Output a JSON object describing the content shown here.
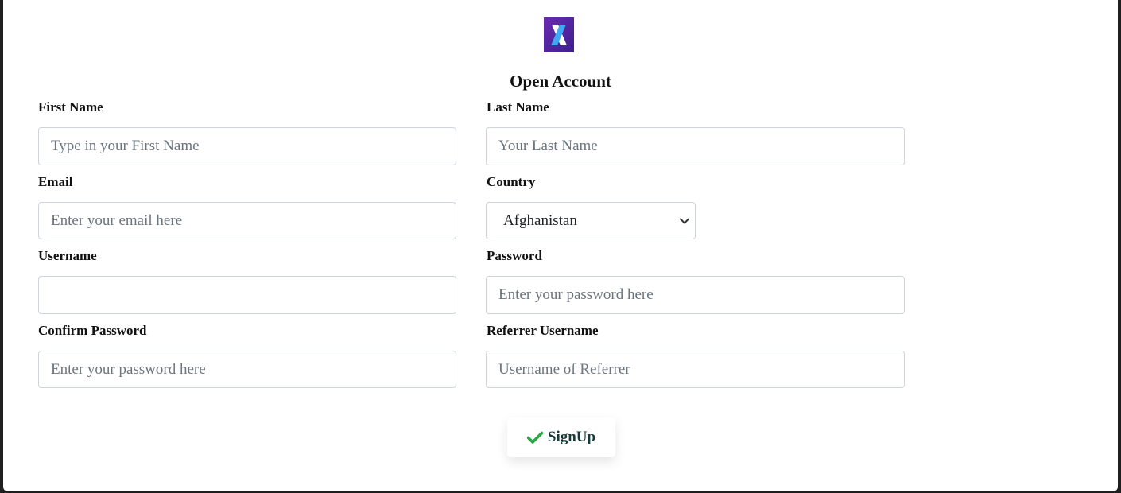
{
  "form": {
    "title": "Open Account",
    "fields": {
      "first_name": {
        "label": "First Name",
        "placeholder": "Type in your First Name",
        "value": ""
      },
      "last_name": {
        "label": "Last Name",
        "placeholder": "Your Last Name",
        "value": ""
      },
      "email": {
        "label": "Email",
        "placeholder": "Enter your email here",
        "value": ""
      },
      "country": {
        "label": "Country",
        "selected": "Afghanistan",
        "icon": "chevron-down-icon"
      },
      "username": {
        "label": "Username",
        "placeholder": "",
        "value": ""
      },
      "password": {
        "label": "Password",
        "placeholder": "Enter your password here",
        "value": ""
      },
      "confirm_password": {
        "label": "Confirm Password",
        "placeholder": "Enter your password here",
        "value": ""
      },
      "referrer_username": {
        "label": "Referrer Username",
        "placeholder": "Username of Referrer",
        "value": ""
      }
    },
    "submit": {
      "label": "SignUp",
      "icon": "check-icon"
    }
  },
  "logo": {
    "icon": "x-logo-icon"
  },
  "colors": {
    "logo_bg": "#5a26a0",
    "logo_accent": "#3fa9f5",
    "check": "#28a745",
    "button_text": "#173a3a",
    "input_border": "#ced4da",
    "placeholder": "#6c757d"
  }
}
